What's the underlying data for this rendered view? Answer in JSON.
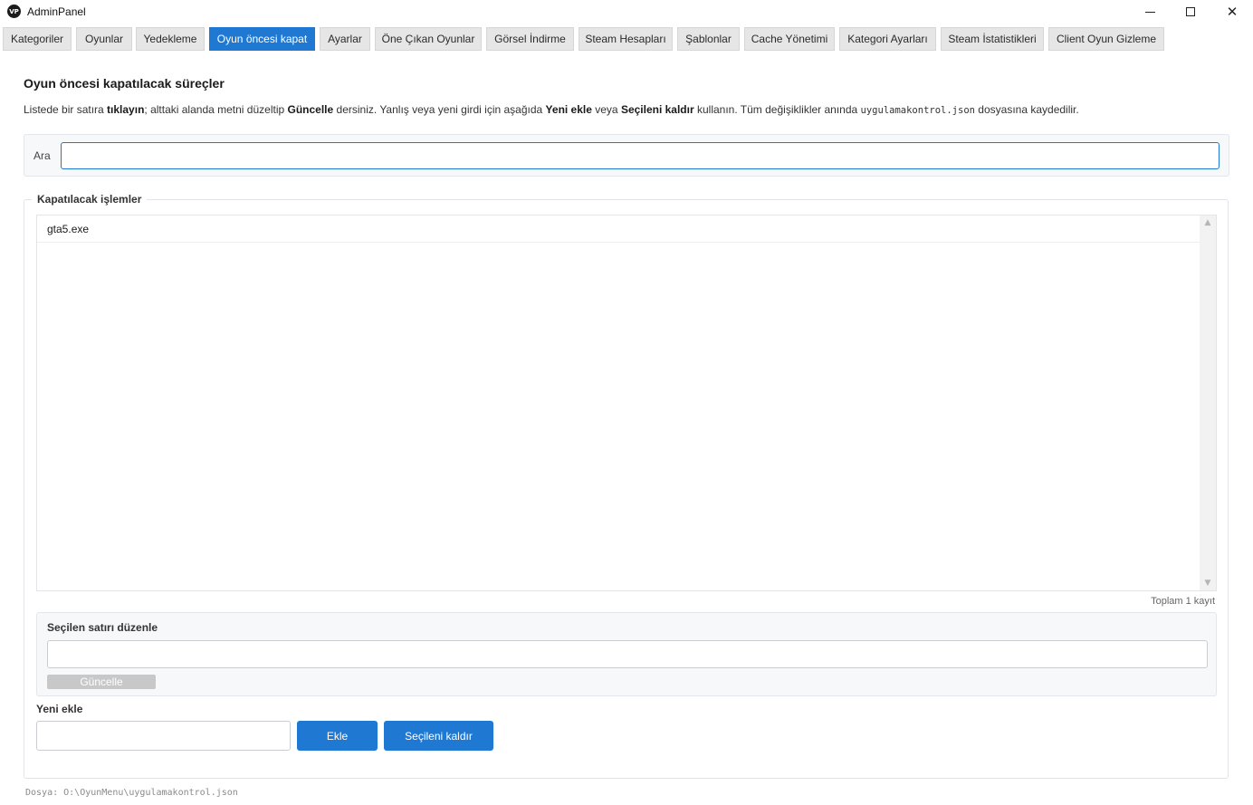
{
  "window": {
    "icon_text": "VP",
    "title": "AdminPanel",
    "minimize_icon": "minimize-icon",
    "maximize_icon": "maximize-icon",
    "close_icon": "close-icon",
    "close_glyph": "✕"
  },
  "tabs": [
    {
      "label": "Kategoriler"
    },
    {
      "label": "Oyunlar"
    },
    {
      "label": "Yedekleme"
    },
    {
      "label": "Oyun öncesi kapat",
      "active": true
    },
    {
      "label": "Ayarlar"
    },
    {
      "label": "Öne Çıkan Oyunlar"
    },
    {
      "label": "Görsel İndirme"
    },
    {
      "label": "Steam Hesapları"
    },
    {
      "label": "Şablonlar"
    },
    {
      "label": "Cache Yönetimi"
    },
    {
      "label": "Kategori Ayarları"
    },
    {
      "label": "Steam İstatistikleri"
    },
    {
      "label": "Client Oyun Gizleme"
    }
  ],
  "main": {
    "heading": "Oyun öncesi kapatılacak süreçler",
    "desc": {
      "t1": "Listede bir satıra ",
      "b1": "tıklayın",
      "t2": "; alttaki alanda metni düzeltip ",
      "b2": "Güncelle",
      "t3": " dersiniz. Yanlış veya yeni girdi için aşağıda ",
      "b3": "Yeni ekle",
      "t4": " veya ",
      "b4": "Seçileni kaldır",
      "t5": " kullanın. Tüm değişiklikler anında ",
      "code": "uygulamakontrol.json",
      "t6": " dosyasına kaydedilir."
    },
    "search": {
      "label": "Ara",
      "value": "",
      "placeholder": ""
    },
    "process_group": {
      "title": "Kapatılacak işlemler",
      "items": [
        "gta5.exe"
      ],
      "scroll_up_glyph": "▲",
      "scroll_down_glyph": "▼",
      "total": "Toplam 1 kayıt"
    },
    "edit": {
      "title": "Seçilen satırı düzenle",
      "value": "",
      "update_label": "Güncelle"
    },
    "new_entry": {
      "title": "Yeni ekle",
      "value": "",
      "add_label": "Ekle",
      "remove_label": "Seçileni kaldır"
    }
  },
  "footer": {
    "path": "Dosya: O:\\OyunMenu\\uygulamakontrol.json"
  },
  "colors": {
    "accent": "#1f78d1",
    "tab_bg": "#e6e6e6",
    "disabled_button": "#c8c8c8"
  }
}
